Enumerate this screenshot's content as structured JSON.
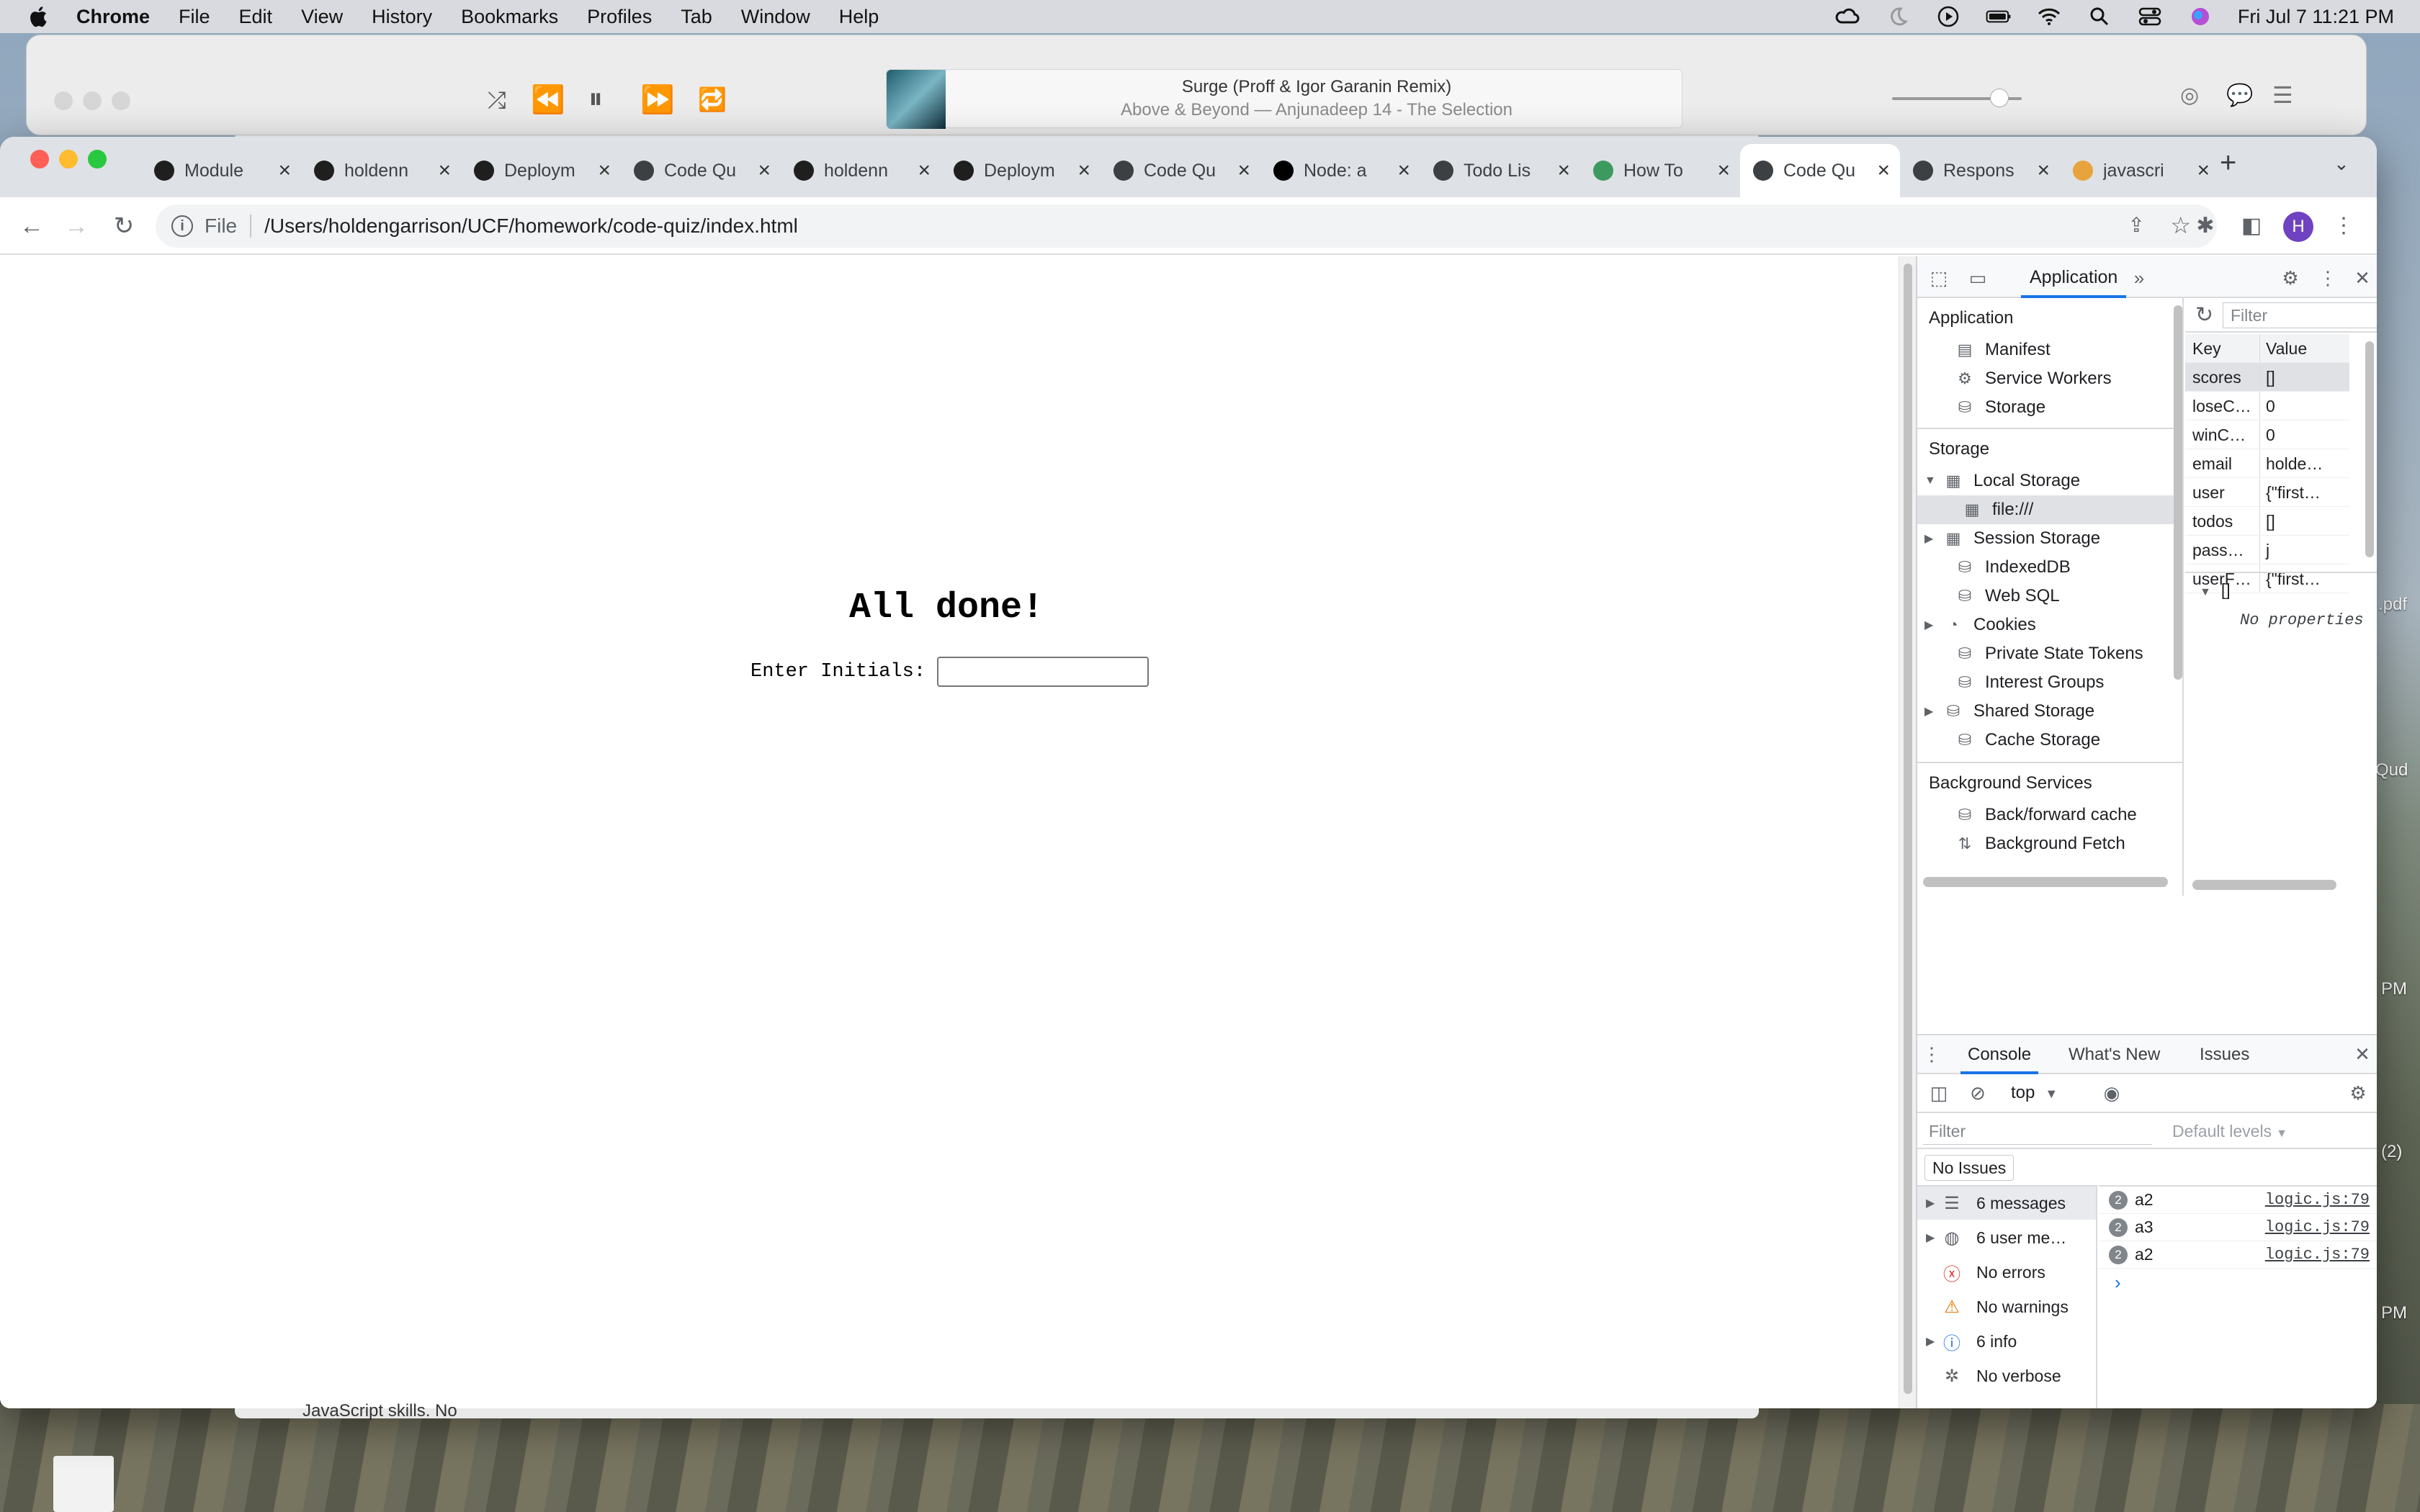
{
  "menubar": {
    "app": "Chrome",
    "items": [
      "File",
      "Edit",
      "View",
      "History",
      "Bookmarks",
      "Profiles",
      "Tab",
      "Window",
      "Help"
    ],
    "datetime": "Fri Jul 7  11:21 PM"
  },
  "music": {
    "title": "Surge (Proff & Igor Garanin Remix)",
    "subtitle": "Above & Beyond — Anjunadeep 14 - The Selection"
  },
  "tabs": [
    {
      "label": "Module",
      "icon": "module-icon",
      "color": "#1f1f1f"
    },
    {
      "label": "holdenn",
      "icon": "github-icon",
      "color": "#1f1f1f"
    },
    {
      "label": "Deploym",
      "icon": "github-icon",
      "color": "#1f1f1f"
    },
    {
      "label": "Code Qu",
      "icon": "globe-icon",
      "color": "#3c4043"
    },
    {
      "label": "holdenn",
      "icon": "github-icon",
      "color": "#1f1f1f"
    },
    {
      "label": "Deploym",
      "icon": "github-icon",
      "color": "#1f1f1f"
    },
    {
      "label": "Code Qu",
      "icon": "globe-icon",
      "color": "#3c4043"
    },
    {
      "label": "Node: a",
      "icon": "medium-icon",
      "color": "#000000"
    },
    {
      "label": "Todo Lis",
      "icon": "globe-icon",
      "color": "#3c4043"
    },
    {
      "label": "How To",
      "icon": "w-icon",
      "color": "#3c9a5f"
    },
    {
      "label": "Code Qu",
      "icon": "globe-icon",
      "color": "#3c4043",
      "active": true
    },
    {
      "label": "Respons",
      "icon": "settings-icon",
      "color": "#3c4043"
    },
    {
      "label": "javascri",
      "icon": "js-icon",
      "color": "#e8a33d"
    }
  ],
  "address": {
    "scheme": "File",
    "url": "/Users/holdengarrison/UCF/homework/code-quiz/index.html"
  },
  "profile_initial": "H",
  "page": {
    "title": "All done!",
    "initials_label": "Enter Initials:",
    "initials_value": ""
  },
  "devtools": {
    "panel_tab": "Application",
    "app_section": {
      "header": "Application",
      "items": [
        "Manifest",
        "Service Workers",
        "Storage"
      ]
    },
    "storage_section": {
      "header": "Storage",
      "items": [
        "Local Storage",
        "file:///",
        "Session Storage",
        "IndexedDB",
        "Web SQL",
        "Cookies",
        "Private State Tokens",
        "Interest Groups",
        "Shared Storage",
        "Cache Storage"
      ]
    },
    "bg_section": {
      "header": "Background Services",
      "items": [
        "Back/forward cache",
        "Background Fetch"
      ]
    },
    "ls_filter_placeholder": "Filter",
    "ls_columns": {
      "key": "Key",
      "value": "Value"
    },
    "ls_rows": [
      {
        "key": "scores",
        "value": "[]"
      },
      {
        "key": "loseC…",
        "value": "0"
      },
      {
        "key": "winC…",
        "value": "0"
      },
      {
        "key": "email",
        "value": "holde…"
      },
      {
        "key": "user",
        "value": "{\"first…"
      },
      {
        "key": "todos",
        "value": "[]"
      },
      {
        "key": "pass…",
        "value": "j"
      },
      {
        "key": "userF…",
        "value": "{\"first…"
      }
    ],
    "preview_root": "[]",
    "preview_empty": "No properties",
    "console_tabs": [
      "Console",
      "What's New",
      "Issues"
    ],
    "context": "top",
    "console_filter_placeholder": "Filter",
    "levels": "Default levels",
    "no_issues": "No Issues",
    "sidebar": [
      {
        "label": "6 messages",
        "icon": "list-icon"
      },
      {
        "label": "6 user me…",
        "icon": "user-icon"
      },
      {
        "label": "No errors",
        "icon": "error-icon"
      },
      {
        "label": "No warnings",
        "icon": "warning-icon"
      },
      {
        "label": "6 info",
        "icon": "info-icon"
      },
      {
        "label": "No verbose",
        "icon": "bug-icon"
      }
    ],
    "messages": [
      {
        "count": "2",
        "text": "a2",
        "source": "logic.js:79"
      },
      {
        "count": "2",
        "text": "a3",
        "source": "logic.js:79"
      },
      {
        "count": "2",
        "text": "a2",
        "source": "logic.js:79"
      }
    ]
  },
  "desktop": {
    "labels": [
      ".pdf",
      "Qud",
      "PM",
      "(2)",
      "PM"
    ],
    "under_text": "JavaScript skills. No"
  }
}
